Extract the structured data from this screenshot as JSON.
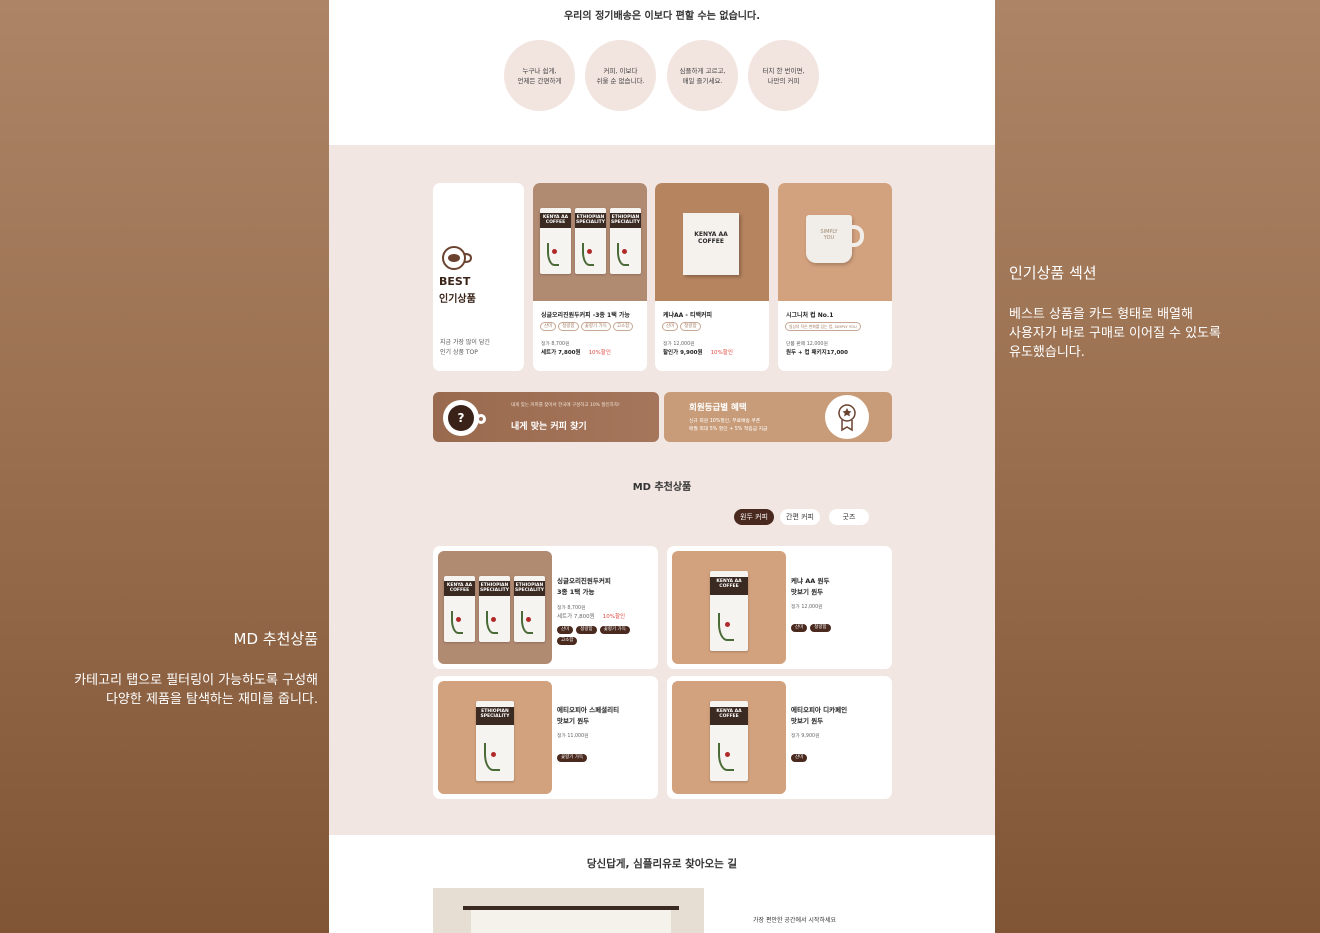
{
  "intro": {
    "headline": "우리의 정기배송은 이보다 편할 수는 없습니다.",
    "features": [
      "누구나 쉽게,\n언제든 간편하게",
      "커피, 이보다\n쉬울 순 없습니다.",
      "심플하게 고르고,\n매일 즐기세요.",
      "터치 한 번이면,\n나만의 커피"
    ]
  },
  "best": {
    "title_line1": "BEST",
    "title_line2": "인기상품",
    "desc_line1": "지금 가장 많이 담긴",
    "desc_line2": "인기 상품 TOP",
    "products": [
      {
        "name": "싱글오리진원두커피 -3종 1택 가능",
        "tags": [
          "산미",
          "청량함",
          "꽃향기 가득",
          "고소함"
        ],
        "price_line1": "정가 8,700원",
        "price_line2": "세트가 7,800원",
        "discount": "10%할인"
      },
      {
        "name": "케냐AA - 티백커피",
        "tags": [
          "산미",
          "청량함"
        ],
        "price_line1": "정가 12,000원",
        "price_line2": "할인가 9,900원",
        "discount": "10%할인"
      },
      {
        "name": "시그니처 컵 No.1",
        "tags": [
          "일상의 작은 변화를 담는 컵, SIMPLY YOU"
        ],
        "price_line1": "단품 판매 12,000원",
        "price_line2": "원두 + 컵 패키지17,000",
        "discount": ""
      }
    ],
    "box_label": "KENYA AA\nCOFFEE",
    "mug_label": "SIMPLY\nYOU"
  },
  "banners": {
    "find_small": "내게 맞는 커피를 찾아서 한국에 구성하고 10% 할인하자!",
    "find_title": "내게 맞는 커피 찾기",
    "member_title": "회원등급별 혜택",
    "member_line1": "신규 회원 10%할인, 무료배송 쿠폰",
    "member_line2": "매월 최대 5% 할인 + 5% 적립금 지급"
  },
  "md": {
    "title": "MD 추천상품",
    "tabs": [
      "원두 커피",
      "간편 커피",
      "굿즈"
    ],
    "products": [
      {
        "name_line1": "싱글오리진원두커피",
        "name_line2": "3종 1택 가능",
        "price_line1": "정가 8,700원",
        "price_line2": "세트가 7,800원",
        "discount": "10%할인",
        "tags": [
          "산미",
          "청량함",
          "꽃향기 가득",
          "고소함"
        ]
      },
      {
        "name_line1": "케냐 AA 원두",
        "name_line2": "맛보기 원두",
        "price_line1": "정가 12,000원",
        "price_line2": "",
        "discount": "",
        "tags": [
          "산미",
          "청량함"
        ]
      },
      {
        "name_line1": "에티오피아 스페셜리티",
        "name_line2": "맛보기 원두",
        "price_line1": "정가 11,000원",
        "price_line2": "",
        "discount": "",
        "tags": [
          "꽃향기 가득"
        ]
      },
      {
        "name_line1": "에티오피아 디카페인",
        "name_line2": "맛보기 원두",
        "price_line1": "정가 9,900원",
        "price_line2": "",
        "discount": "",
        "tags": [
          "산미"
        ]
      }
    ]
  },
  "bag_labels": {
    "kenya": "KENYA AA\nCOFFEE",
    "ethiopian": "ETHIOPIAN\nSPECIALITY"
  },
  "footer": {
    "title": "당신답게, 심플리유로 찾아오는 길",
    "small": "가장 편안한 공간에서 시작하세요"
  },
  "side_right": {
    "title": "인기상품 섹션",
    "line1": "베스트 상품을 카드 형태로 배열해",
    "line2": "사용자가 바로 구매로 이어질 수 있도록",
    "line3": "유도했습니다."
  },
  "side_left": {
    "title": "MD 추천상품",
    "line1": "카테고리 탭으로 필터링이 가능하도록 구성해",
    "line2": "다양한 제품을 탐색하는 재미를 줍니다."
  },
  "colors": {
    "brown_dark": "#4a2a1f",
    "beige_bg": "#f1e6e1",
    "tan": "#c89c79",
    "discount": "#e0483f"
  }
}
